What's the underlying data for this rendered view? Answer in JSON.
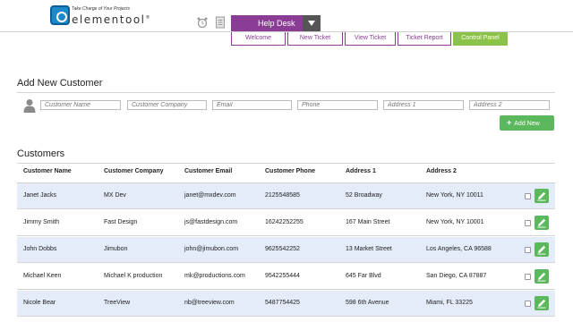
{
  "logo": {
    "tagline": "Take Charge of Your Projects",
    "name": "elementool",
    "reg": "®"
  },
  "header": {
    "menu_label": "Help Desk"
  },
  "tabs": [
    {
      "label": "Welcome"
    },
    {
      "label": "New Ticket"
    },
    {
      "label": "View Ticket"
    },
    {
      "label": "Ticket Report"
    },
    {
      "label": "Control Panel",
      "active": true
    }
  ],
  "add_customer": {
    "title": "Add New Customer",
    "fields": [
      {
        "placeholder": "Customer Name",
        "value": ""
      },
      {
        "placeholder": "Customer Company",
        "value": ""
      },
      {
        "placeholder": "Email",
        "value": ""
      },
      {
        "placeholder": "Phone",
        "value": ""
      },
      {
        "placeholder": "Address 1",
        "value": ""
      },
      {
        "placeholder": "Address 2",
        "value": ""
      }
    ],
    "add_button": "Add New"
  },
  "customers": {
    "title": "Customers",
    "columns": [
      "Customer Name",
      "Customer Company",
      "Customer Email",
      "Customer Phone",
      "Address 1",
      "Address 2"
    ],
    "rows": [
      [
        "Janet Jacks",
        "MX Dev",
        "janet@mxdev.com",
        "2125548585",
        "52 Broadway",
        "New York, NY 10011"
      ],
      [
        "Jimmy Smith",
        "Fast Design",
        "js@fastdesign.com",
        "16242252255",
        "167 Main Street",
        "New York, NY 10001"
      ],
      [
        "John Dobbs",
        "Jimubon",
        "john@jimubon.com",
        "9625542252",
        "13 Market Street",
        "Los Angeles, CA 96588"
      ],
      [
        "Michael Keen",
        "Michael K production",
        "mk@productions.com",
        "9542255444",
        "645 Far Blvd",
        "San Diego, CA 87887"
      ],
      [
        "Nicole Bear",
        "TreeView",
        "nb@treeview.com",
        "5487754425",
        "598 6th Avenue",
        "Miami, FL 33225"
      ]
    ]
  },
  "colors": {
    "brand_purple": "#8b3d95",
    "accent_green": "#5cb85c",
    "row_alt": "#e3ecf8"
  },
  "icons": [
    "alarm-clock-icon",
    "notes-icon",
    "chevron-down-icon",
    "person-icon",
    "plus-icon",
    "pencil-icon"
  ]
}
